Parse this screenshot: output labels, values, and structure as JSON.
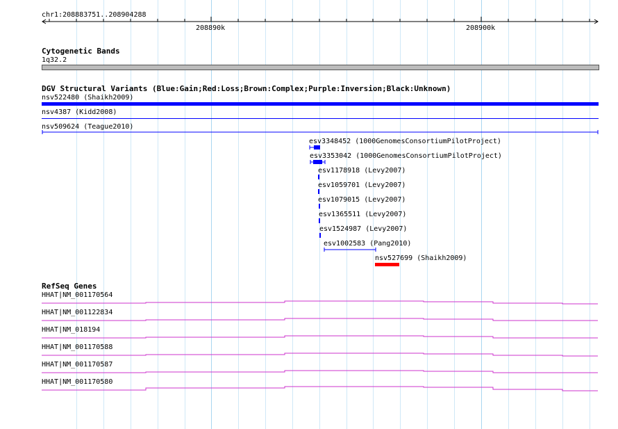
{
  "position_label": "chr1:208883751..208904288",
  "scale_ticks": [
    {
      "label": "208890k"
    },
    {
      "label": "208900k"
    }
  ],
  "cytoband": {
    "title": "Cytogenetic Bands",
    "label": "1q32.2"
  },
  "dgv": {
    "title": "DGV Structural Variants (Blue:Gain;Red:Loss;Brown:Complex;Purple:Inversion;Black:Unknown)",
    "variants": [
      {
        "label": "nsv522480 (Shaikh2009)",
        "color": "#0000ff"
      },
      {
        "label": "nsv4387 (Kidd2008)",
        "color": "#0000ff"
      },
      {
        "label": "nsv509624 (Teague2010)",
        "color": "#0000ff"
      },
      {
        "label": "esv3348452 (1000GenomesConsortiumPilotProject)",
        "color": "#0000ff"
      },
      {
        "label": "esv3353042 (1000GenomesConsortiumPilotProject)",
        "color": "#0000ff"
      },
      {
        "label": "esv1178918 (Levy2007)",
        "color": "#0000ff"
      },
      {
        "label": "esv1059701 (Levy2007)",
        "color": "#0000ff"
      },
      {
        "label": "esv1079015 (Levy2007)",
        "color": "#0000ff"
      },
      {
        "label": "esv1365511 (Levy2007)",
        "color": "#0000ff"
      },
      {
        "label": "esv1524987 (Levy2007)",
        "color": "#0000ff"
      },
      {
        "label": "esv1002583 (Pang2010)",
        "color": "#0000ff"
      },
      {
        "label": "nsv527699 (Shaikh2009)",
        "color": "#ff0000"
      }
    ]
  },
  "refseq": {
    "title": "RefSeq Genes",
    "genes": [
      {
        "label": "HHAT|NM_001170564",
        "color": "#cc33cc"
      },
      {
        "label": "HHAT|NM_001122834",
        "color": "#cc33cc"
      },
      {
        "label": "HHAT|NM_018194",
        "color": "#cc33cc"
      },
      {
        "label": "HHAT|NM_001170588",
        "color": "#cc33cc"
      },
      {
        "label": "HHAT|NM_001170587",
        "color": "#cc33cc"
      },
      {
        "label": "HHAT|NM_001170580",
        "color": "#cc33cc"
      }
    ]
  },
  "colors": {
    "gridline": "#a9d6f0",
    "cytoband_fill": "#bbbbbb",
    "gain": "#0000ff",
    "loss": "#ff0000",
    "gene": "#cc33cc"
  }
}
